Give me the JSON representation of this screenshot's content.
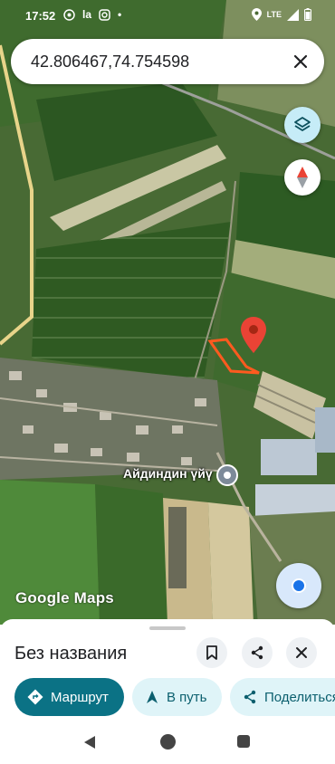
{
  "status_bar": {
    "time": "17:52",
    "la_label": "la",
    "network": "LTE"
  },
  "search": {
    "query": "42.806467,74.754598"
  },
  "map": {
    "place_label": "Айдиндин үйү",
    "logo_text": "Google Maps",
    "pin_color": "#ea4335",
    "area_outline_color": "#ff5a1f"
  },
  "sheet": {
    "title": "Без названия",
    "chips": {
      "route": "Маршрут",
      "go": "В путь",
      "share": "Поделиться"
    }
  },
  "colors": {
    "accent": "#0b7285",
    "chip_light": "#dff4f8"
  }
}
